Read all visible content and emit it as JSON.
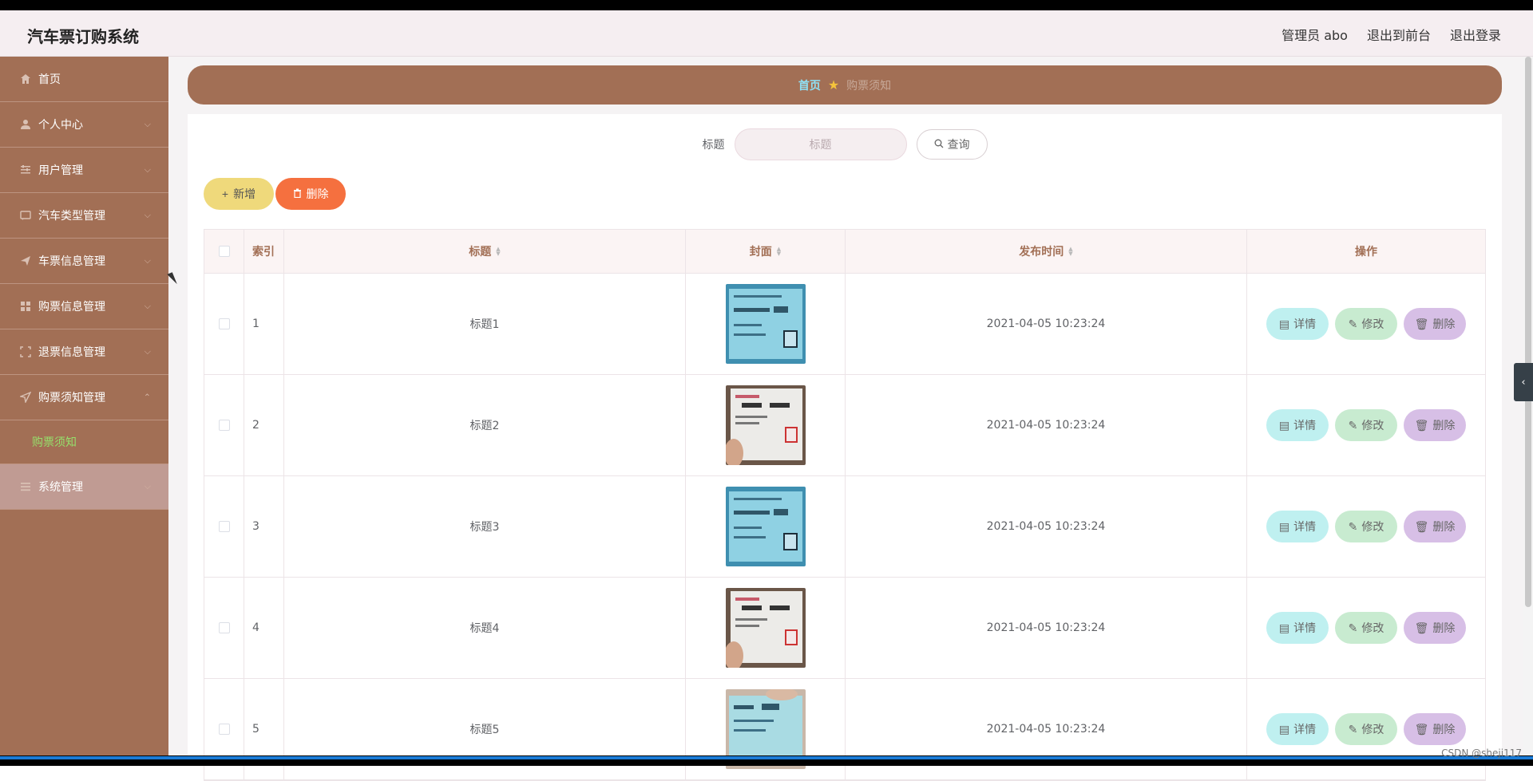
{
  "app": {
    "title": "汽车票订购系统",
    "admin_label": "管理员 abo",
    "exit_front": "退出到前台",
    "logout": "退出登录"
  },
  "sidebar": {
    "items": [
      {
        "label": "首页",
        "icon": "home-icon"
      },
      {
        "label": "个人中心",
        "icon": "user-icon"
      },
      {
        "label": "用户管理",
        "icon": "sliders-icon"
      },
      {
        "label": "汽车类型管理",
        "icon": "message-icon"
      },
      {
        "label": "车票信息管理",
        "icon": "send-icon"
      },
      {
        "label": "购票信息管理",
        "icon": "grid-icon"
      },
      {
        "label": "退票信息管理",
        "icon": "frame-icon"
      },
      {
        "label": "购票须知管理",
        "icon": "navigate-icon"
      },
      {
        "label": "系统管理",
        "icon": "menu-icon"
      }
    ],
    "sub_item": "购票须知"
  },
  "breadcrumb": {
    "home": "首页",
    "current": "购票须知"
  },
  "search": {
    "label": "标题",
    "placeholder": "标题",
    "button": "查询"
  },
  "toolbar": {
    "add": "新增",
    "delete": "删除"
  },
  "table": {
    "headers": {
      "index": "索引",
      "title": "标题",
      "cover": "封面",
      "time": "发布时间",
      "ops": "操作"
    },
    "op_labels": {
      "detail": "详情",
      "edit": "修改",
      "delete": "删除"
    },
    "rows": [
      {
        "index": "1",
        "title": "标题1",
        "time": "2021-04-05 10:23:24",
        "cover": "blue-ticket"
      },
      {
        "index": "2",
        "title": "标题2",
        "time": "2021-04-05 10:23:24",
        "cover": "white-ticket-hand"
      },
      {
        "index": "3",
        "title": "标题3",
        "time": "2021-04-05 10:23:24",
        "cover": "blue-ticket"
      },
      {
        "index": "4",
        "title": "标题4",
        "time": "2021-04-05 10:23:24",
        "cover": "white-ticket-hand"
      },
      {
        "index": "5",
        "title": "标题5",
        "time": "2021-04-05 10:23:24",
        "cover": "blue-ticket-hand"
      }
    ]
  },
  "watermark": "CSDN @sheji117",
  "colors": {
    "sidebar": "#a26f55",
    "header": "#f5eef1",
    "accent_green": "#95e06b",
    "breadcrumb_home": "#8fe0f5"
  }
}
